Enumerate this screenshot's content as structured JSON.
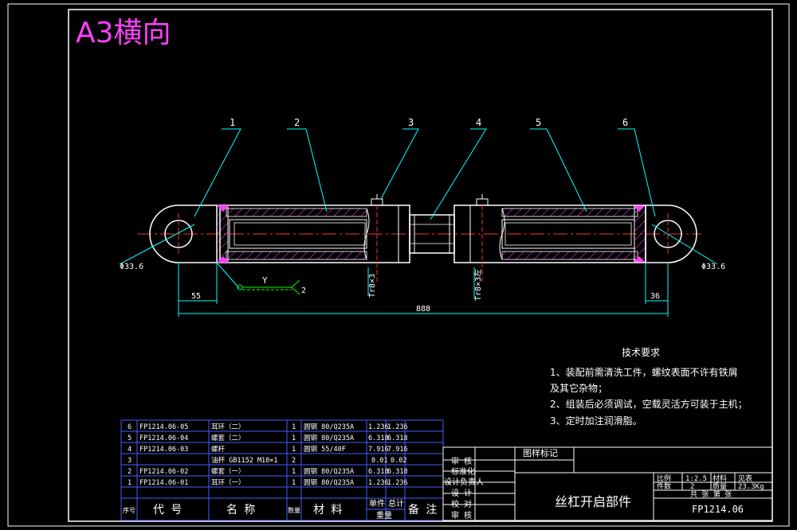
{
  "title": "A3横向",
  "balloons": [
    "1",
    "2",
    "3",
    "4",
    "5",
    "6"
  ],
  "dimensions": {
    "left_dia": "Φ33.6",
    "right_dia": "Φ33.6",
    "left_len": "55",
    "right_len": "36",
    "total_len": "888",
    "thread_left": "Tr8×3",
    "thread_right": "Tr8×3左"
  },
  "weld_symbol": {
    "label": "Y",
    "num": "2"
  },
  "tech_req": {
    "title": "技术要求",
    "lines": [
      "1、装配前需清洗工件，螺纹表面不许有铁屑",
      "及其它杂物；",
      "2、组装后必须调试，空载灵活方可装于主机；",
      "3、定时加注润滑脂。"
    ]
  },
  "bom": {
    "rows": [
      {
        "no": "6",
        "code": "FP1214.06-05",
        "name": "耳环（二）",
        "qty": "1",
        "mat": "圆钢 80/Q235A",
        "w1": "1.236",
        "w2": "1.236"
      },
      {
        "no": "5",
        "code": "FP1214.06-04",
        "name": "螺套（二）",
        "qty": "1",
        "mat": "圆钢 80/Q235A",
        "w1": "6.318",
        "w2": "6.318"
      },
      {
        "no": "4",
        "code": "FP1214.06-03",
        "name": "螺杆",
        "qty": "1",
        "mat": "圆钢 55/40F",
        "w1": "7.916",
        "w2": "7.916"
      },
      {
        "no": "3",
        "code": "",
        "name": "油杯 GB1152 M10×1",
        "qty": "2",
        "mat": "",
        "w1": "0.01",
        "w2": "0.02"
      },
      {
        "no": "2",
        "code": "FP1214.06-02",
        "name": "螺套（一）",
        "qty": "1",
        "mat": "圆钢 80/Q235A",
        "w1": "6.318",
        "w2": "6.318"
      },
      {
        "no": "1",
        "code": "FP1214.06-01",
        "name": "耳环（一）",
        "qty": "1",
        "mat": "圆钢 80/Q235A",
        "w1": "1.236",
        "w2": "1.236"
      }
    ],
    "header": {
      "no": "序号",
      "code": "代 号",
      "name": "名 称",
      "qty": "数量",
      "mat": "材 料",
      "single": "单件",
      "total": "总计",
      "weight": "重量",
      "remark": "备 注"
    }
  },
  "title_block": {
    "roles": [
      "审 核",
      "标准化",
      "设计负责人",
      "设 计",
      "校 对",
      "审 核"
    ],
    "drawing_label": "图样标记",
    "drawing_name": "丝杠开启部件",
    "drawing_no": "FP1214.06",
    "scale_label": "比例",
    "scale": "1:2.5",
    "material_label": "材料",
    "material": "见表",
    "count_label": "件数",
    "count": "2",
    "weight_label": "质量",
    "weight": "23.3Kg",
    "sheet_label": "共 张 第 张"
  }
}
